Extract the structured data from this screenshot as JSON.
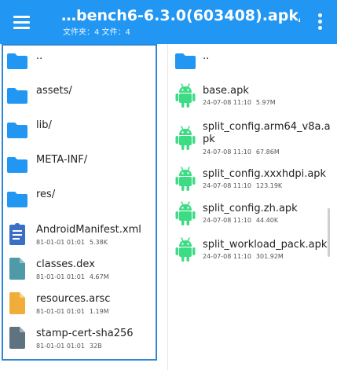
{
  "appbar": {
    "title": "…bench6-6.3.0(603408).apk/",
    "subtitle": "文件夹：4  文件：4",
    "menu_icon": "hamburger-menu-icon",
    "more_icon": "more-vert-icon"
  },
  "colors": {
    "appbar": "#2196f3",
    "folder": "#2196f3",
    "android": "#3ddc84",
    "xml_doc": "#3a6ec7",
    "dex": "#4e9aa8",
    "arsc": "#f0ad3a",
    "sha": "#5f7280",
    "selection_border": "#2f86d8"
  },
  "left_pane": {
    "items": [
      {
        "name": "..",
        "type": "folder"
      },
      {
        "name": "assets/",
        "type": "folder"
      },
      {
        "name": "lib/",
        "type": "folder"
      },
      {
        "name": "META-INF/",
        "type": "folder"
      },
      {
        "name": "res/",
        "type": "folder"
      },
      {
        "name": "AndroidManifest.xml",
        "type": "xml",
        "date": "81-01-01 01:01",
        "size": "5.38K"
      },
      {
        "name": "classes.dex",
        "type": "dex",
        "date": "81-01-01 01:01",
        "size": "4.67M"
      },
      {
        "name": "resources.arsc",
        "type": "arsc",
        "date": "81-01-01 01:01",
        "size": "1.19M"
      },
      {
        "name": "stamp-cert-sha256",
        "type": "sha",
        "date": "81-01-01 01:01",
        "size": "32B"
      }
    ]
  },
  "right_pane": {
    "items": [
      {
        "name": "..",
        "type": "folder"
      },
      {
        "name": "base.apk",
        "type": "apk",
        "date": "24-07-08 11:10",
        "size": "5.97M"
      },
      {
        "name": "split_config.arm64_v8a.apk",
        "type": "apk",
        "date": "24-07-08 11:10",
        "size": "67.86M"
      },
      {
        "name": "split_config.xxxhdpi.apk",
        "type": "apk",
        "date": "24-07-08 11:10",
        "size": "123.19K"
      },
      {
        "name": "split_config.zh.apk",
        "type": "apk",
        "date": "24-07-08 11:10",
        "size": "44.40K"
      },
      {
        "name": "split_workload_pack.apk",
        "type": "apk",
        "date": "24-07-08 11:10",
        "size": "301.92M"
      }
    ]
  }
}
